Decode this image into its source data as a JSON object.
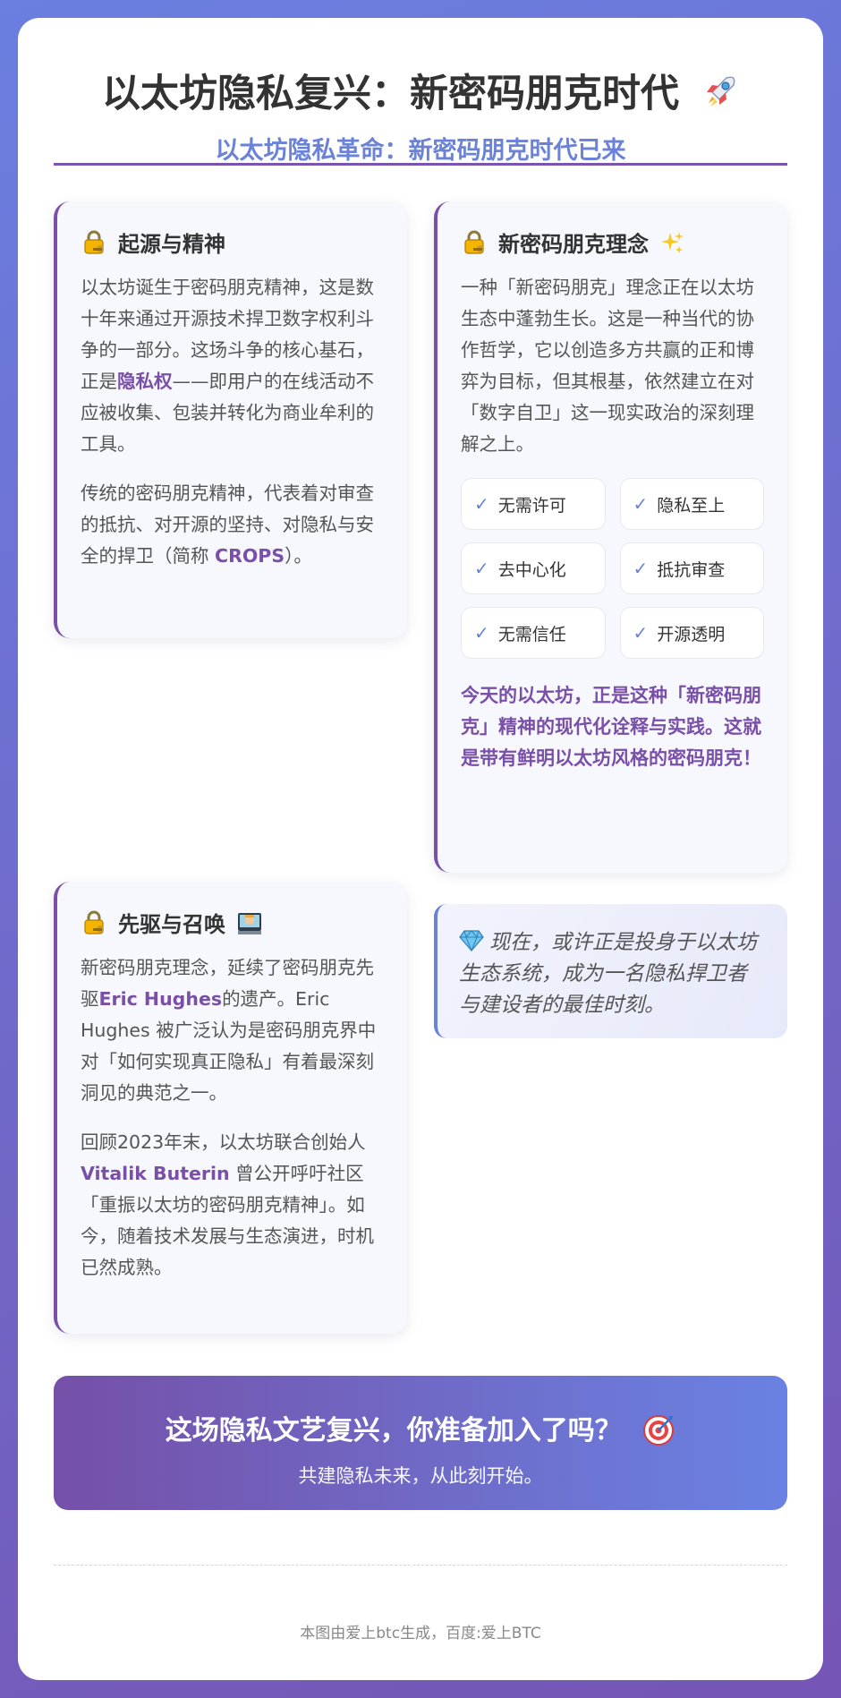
{
  "header": {
    "title": "以太坊隐私复兴：新密码朋克时代",
    "title_icon": "rocket-icon",
    "subtitle": "以太坊隐私革命：新密码朋克时代已来"
  },
  "origin": {
    "heading": "起源与精神",
    "icon": "lock-key-icon",
    "p1_a": "以太坊诞生于密码朋克精神，这是数十年来通过开源技术捍卫数字权利斗争的一部分。这场斗争的核心基石，正是",
    "p1_hl": "隐私权",
    "p1_b": "——即用户的在线活动不应被收集、包装并转化为商业牟利的工具。",
    "p2_a": "传统的密码朋克精神，代表着对审查的抵抗、对开源的坚持、对隐私与安全的捍卫（简称 ",
    "p2_hl": "CROPS",
    "p2_b": "）。"
  },
  "concept": {
    "heading": "新密码朋克理念",
    "icon": "lock-key-icon",
    "icon2": "sparkles-icon",
    "p1": "一种「新密码朋克」理念正在以太坊生态中蓬勃生长。这是一种当代的协作哲学，它以创造多方共赢的正和博弈为目标，但其根基，依然建立在对「数字自卫」这一现实政治的深刻理解之上。",
    "checks": [
      "无需许可",
      "隐私至上",
      "去中心化",
      "抵抗审查",
      "无需信任",
      "开源透明"
    ],
    "emphasis": "今天的以太坊，正是这种「新密码朋克」精神的现代化诠释与实践。这就是带有鲜明以太坊风格的密码朋克！"
  },
  "pioneers": {
    "heading": "先驱与召唤",
    "icon": "lock-key-icon",
    "icon2": "hacker-icon",
    "p1_a": "新密码朋克理念，延续了密码朋克先驱",
    "p1_hl": "Eric Hughes",
    "p1_b": "的遗产。Eric Hughes 被广泛认为是密码朋克界中对「如何实现真正隐私」有着最深刻洞见的典范之一。",
    "p2_a": "回顾2023年末，以太坊联合创始人 ",
    "p2_hl": "Vitalik Buterin",
    "p2_b": " 曾公开呼吁社区「重振以太坊的密码朋克精神」。如今，随着技术发展与生态演进，时机已然成熟。"
  },
  "quote": {
    "icon": "gem-icon",
    "text": "现在，或许正是投身于以太坊生态系统，成为一名隐私捍卫者与建设者的最佳时刻。"
  },
  "cta": {
    "title": "这场隐私文艺复兴，你准备加入了吗？",
    "icon": "target-icon",
    "subtitle": "共建隐私未来，从此刻开始。"
  },
  "footer": {
    "text": "本图由爱上btc生成，百度:爱上BTC"
  },
  "colors": {
    "accent_purple": "#7a4fa8",
    "accent_blue": "#6a82d8"
  }
}
